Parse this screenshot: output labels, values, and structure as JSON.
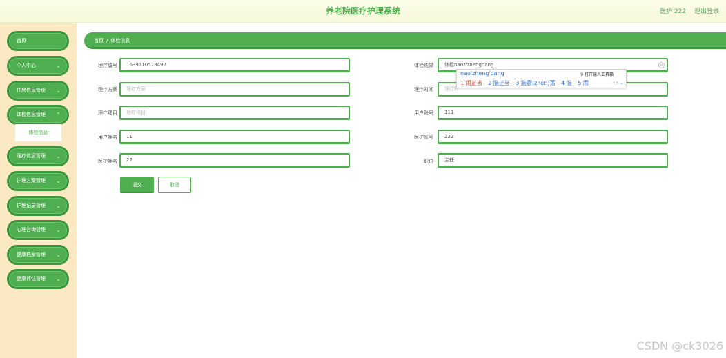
{
  "header": {
    "title": "养老院医疗护理系统",
    "user": "医护 222",
    "logout": "退出登录"
  },
  "sidebar": {
    "items": [
      {
        "label": "首页"
      },
      {
        "label": "个人中心"
      },
      {
        "label": "住房信息管理"
      },
      {
        "label": "体检信息管理"
      },
      {
        "label": "理疗信息管理"
      },
      {
        "label": "护理方案管理"
      },
      {
        "label": "护理记录管理"
      },
      {
        "label": "心理咨询管理"
      },
      {
        "label": "健康档案管理"
      },
      {
        "label": "健康评估管理"
      }
    ],
    "submenu": {
      "label": "体检信息"
    }
  },
  "breadcrumb": {
    "home": "首页",
    "sep": "/",
    "current": "体检信息"
  },
  "form": {
    "left": [
      {
        "label": "理疗编号",
        "value": "1639710578492",
        "placeholder": ""
      },
      {
        "label": "理疗方案",
        "value": "",
        "placeholder": "理疗方案"
      },
      {
        "label": "理疗项目",
        "value": "",
        "placeholder": "理疗项目"
      },
      {
        "label": "用户姓名",
        "value": "11",
        "placeholder": ""
      },
      {
        "label": "医护姓名",
        "value": "22",
        "placeholder": ""
      }
    ],
    "right": [
      {
        "label": "体检结果",
        "value": "体检naoz'zhengdang",
        "placeholder": ""
      },
      {
        "label": "理疗时间",
        "value": "",
        "placeholder": "理疗时"
      },
      {
        "label": "用户账号",
        "value": "111",
        "placeholder": ""
      },
      {
        "label": "医护账号",
        "value": "222",
        "placeholder": ""
      },
      {
        "label": "职位",
        "value": "主任",
        "placeholder": ""
      }
    ],
    "submit": "提交",
    "cancel": "取消"
  },
  "ime": {
    "pinyin": "nao'zheng'dang",
    "toolbox": "9 打开输入工具箱",
    "candidates": [
      "1 闹正当",
      "2 脑正当",
      "3 脑震(zhen)荡",
      "4 脑",
      "5 闹"
    ],
    "nav": "‹ › ⌄"
  },
  "watermark": "CSDN @ck3026"
}
